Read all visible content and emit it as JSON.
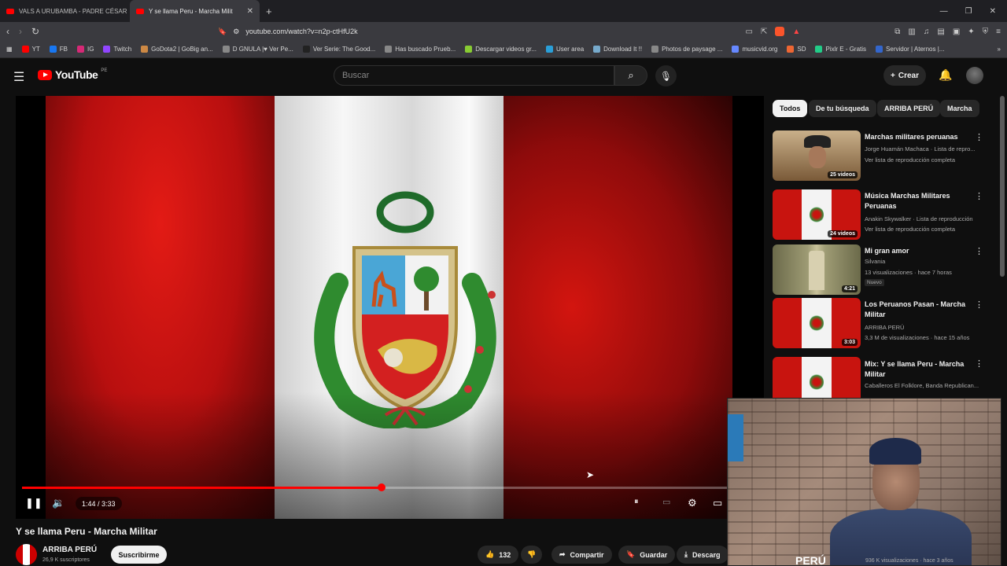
{
  "browser": {
    "tabs": [
      {
        "label": "VALS A URUBAMBA - PADRE CÉSAR"
      },
      {
        "label": "Y se llama Peru - Marcha Milit",
        "active": true
      }
    ],
    "url": "youtube.com/watch?v=n2p-ctHfU2k",
    "bookmarks": [
      "YT",
      "FB",
      "IG",
      "Twitch",
      "GoDota2 | GoBig an...",
      "D GNULA |♥ Ver Pe...",
      "Ver Serie: The Good...",
      "Has buscado Prueb...",
      "Descargar videos gr...",
      "User area",
      "Download It !!",
      "Photos de paysage ...",
      "musicvid.org",
      "SD",
      "Pixlr E - Gratis",
      "Servidor | Aternos |..."
    ]
  },
  "header": {
    "logo_text": "YouTube",
    "country_code": "PE",
    "search_placeholder": "Buscar",
    "create_label": "Crear"
  },
  "player": {
    "current_time": "1:44",
    "duration": "3:33",
    "time_text": "1:44 / 3:33",
    "progress_fraction": 0.4883,
    "colors": {
      "flag_red": "#d3150f",
      "flag_white": "#f3f3f3",
      "progress": "#ff0000"
    }
  },
  "video_info": {
    "title": "Y se llama Peru - Marcha Militar",
    "channel": "ARRIBA PERÚ",
    "subscribers": "26,9 K suscriptores",
    "subscribe_label": "Suscribirme",
    "likes": "132",
    "share_label": "Compartir",
    "save_label": "Guardar",
    "download_label": "Descarg"
  },
  "chips": [
    "Todos",
    "De tu búsqueda",
    "ARRIBA PERÚ",
    "Marcha"
  ],
  "recommendations": [
    {
      "title": "Marchas militares peruanas",
      "meta1": "Jorge Huamán Machaca · Lista de repro...",
      "meta2": "Ver lista de reproducción completa",
      "badge": "25 videos",
      "thumb": "portrait"
    },
    {
      "title": "Música Marchas Militares Peruanas",
      "meta1": "Anakin Skywalker · Lista de reproducción",
      "meta2": "Ver lista de reproducción completa",
      "badge": "24 videos",
      "thumb": "flag"
    },
    {
      "title": "Mi gran amor",
      "meta1": "Silvania",
      "meta2": "13 visualizaciones · hace 7 horas",
      "extra": "Nuevo",
      "badge": "4:21",
      "thumb": "church"
    },
    {
      "title": "Los Peruanos Pasan - Marcha Militar",
      "meta1": "ARRIBA PERÚ",
      "meta2": "3,3 M de visualizaciones · hace 15 años",
      "badge": "3:03",
      "thumb": "flag"
    },
    {
      "title": "Mix: Y se llama Peru - Marcha Militar",
      "meta1": "Caballeros El Folklore, Banda Republican...",
      "thumb": "flag"
    }
  ],
  "webcam": {
    "caption_left": "PERÚ",
    "caption_right": "936 K visualizaciones · hace 3 años"
  }
}
